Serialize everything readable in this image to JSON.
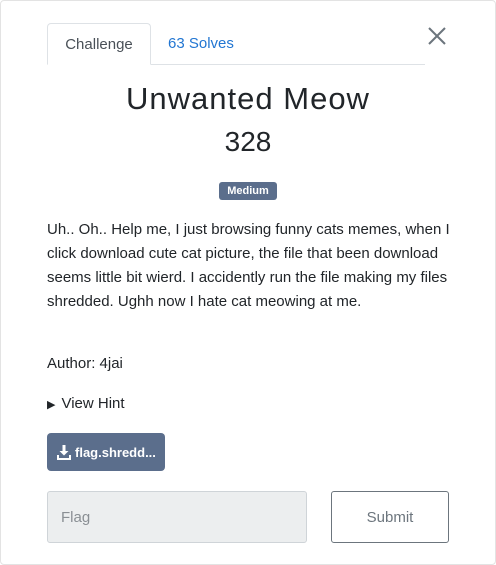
{
  "tabs": [
    {
      "label": "Challenge",
      "active": true
    },
    {
      "label": "63 Solves",
      "active": false
    }
  ],
  "close_icon": "close-icon",
  "challenge": {
    "title": "Unwanted Meow",
    "points": "328",
    "difficulty": "Medium",
    "description": "Uh.. Oh.. Help me, I just browsing funny cats memes, when I click download cute cat picture, the file that been download seems little bit wierd. I accidently run the file making my files shredded. Ughh now I hate cat meowing at me.",
    "author": "Author: 4jai",
    "hint_label": "View Hint",
    "file_label": "flag.shredd..."
  },
  "form": {
    "flag_placeholder": "Flag",
    "submit_label": "Submit"
  },
  "colors": {
    "accent": "#2276d2",
    "badge": "#5b6e8c",
    "file_button": "#5b6e8c"
  }
}
